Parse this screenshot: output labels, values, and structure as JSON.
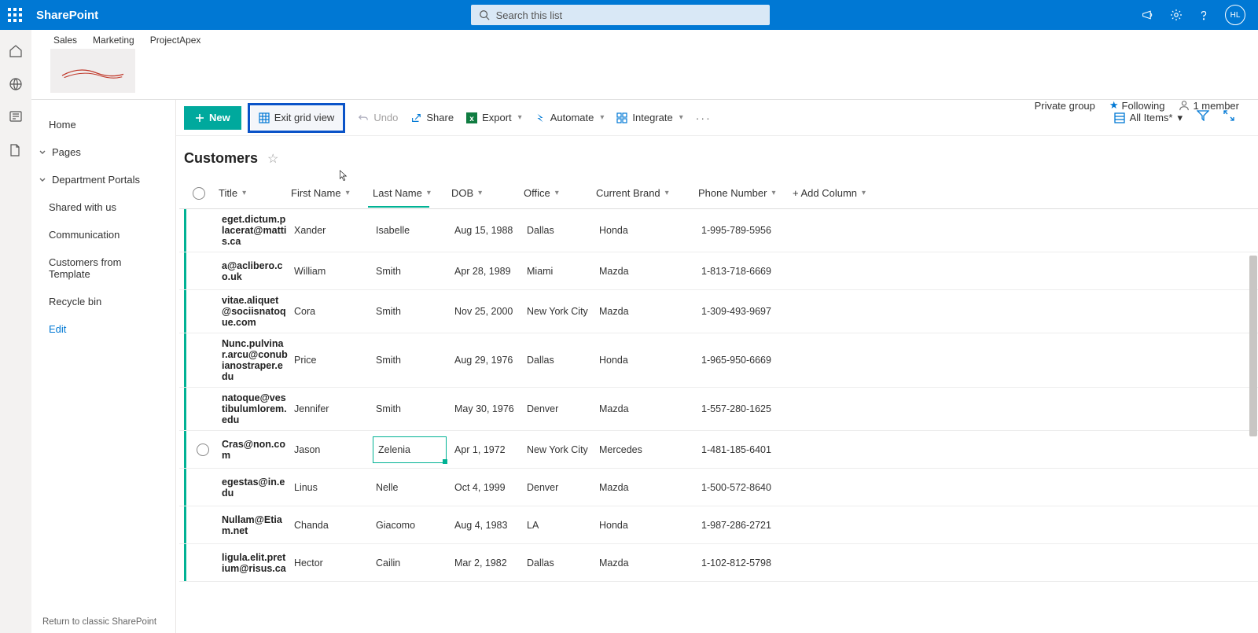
{
  "suite": {
    "title": "SharePoint",
    "search_placeholder": "Search this list",
    "avatar_initials": "HL"
  },
  "breadcrumbs": [
    "Sales",
    "Marketing",
    "ProjectApex"
  ],
  "site_meta": {
    "privacy": "Private group",
    "following_label": "Following",
    "members_label": "1 member"
  },
  "left_nav": {
    "home": "Home",
    "pages": "Pages",
    "dept": "Department Portals",
    "shared": "Shared with us",
    "comm": "Communication",
    "cft": "Customers from Template",
    "recycle": "Recycle bin",
    "edit": "Edit",
    "return": "Return to classic SharePoint"
  },
  "cmd": {
    "new": "New",
    "exit_grid": "Exit grid view",
    "undo": "Undo",
    "share": "Share",
    "export": "Export",
    "automate": "Automate",
    "integrate": "Integrate",
    "view_label": "All Items*"
  },
  "list": {
    "title": "Customers"
  },
  "columns": {
    "title": "Title",
    "first": "First Name",
    "last": "Last Name",
    "dob": "DOB",
    "office": "Office",
    "brand": "Current Brand",
    "phone": "Phone Number",
    "add": "+ Add Column"
  },
  "rows": [
    {
      "title": "eget.dictum.placerat@mattis.ca",
      "first": "Xander",
      "last": "Isabelle",
      "dob": "Aug 15, 1988",
      "office": "Dallas",
      "brand": "Honda",
      "phone": "1-995-789-5956"
    },
    {
      "title": "a@aclibero.co.uk",
      "first": "William",
      "last": "Smith",
      "dob": "Apr 28, 1989",
      "office": "Miami",
      "brand": "Mazda",
      "phone": "1-813-718-6669"
    },
    {
      "title": "vitae.aliquet@sociisnatoque.com",
      "first": "Cora",
      "last": "Smith",
      "dob": "Nov 25, 2000",
      "office": "New York City",
      "brand": "Mazda",
      "phone": "1-309-493-9697"
    },
    {
      "title": "Nunc.pulvinar.arcu@conubianostraper.edu",
      "first": "Price",
      "last": "Smith",
      "dob": "Aug 29, 1976",
      "office": "Dallas",
      "brand": "Honda",
      "phone": "1-965-950-6669"
    },
    {
      "title": "natoque@vestibulumlorem.edu",
      "first": "Jennifer",
      "last": "Smith",
      "dob": "May 30, 1976",
      "office": "Denver",
      "brand": "Mazda",
      "phone": "1-557-280-1625"
    },
    {
      "title": "Cras@non.com",
      "first": "Jason",
      "last": "Zelenia",
      "dob": "Apr 1, 1972",
      "office": "New York City",
      "brand": "Mercedes",
      "phone": "1-481-185-6401",
      "editing": true
    },
    {
      "title": "egestas@in.edu",
      "first": "Linus",
      "last": "Nelle",
      "dob": "Oct 4, 1999",
      "office": "Denver",
      "brand": "Mazda",
      "phone": "1-500-572-8640"
    },
    {
      "title": "Nullam@Etiam.net",
      "first": "Chanda",
      "last": "Giacomo",
      "dob": "Aug 4, 1983",
      "office": "LA",
      "brand": "Honda",
      "phone": "1-987-286-2721"
    },
    {
      "title": "ligula.elit.pretium@risus.ca",
      "first": "Hector",
      "last": "Cailin",
      "dob": "Mar 2, 1982",
      "office": "Dallas",
      "brand": "Mazda",
      "phone": "1-102-812-5798"
    }
  ]
}
